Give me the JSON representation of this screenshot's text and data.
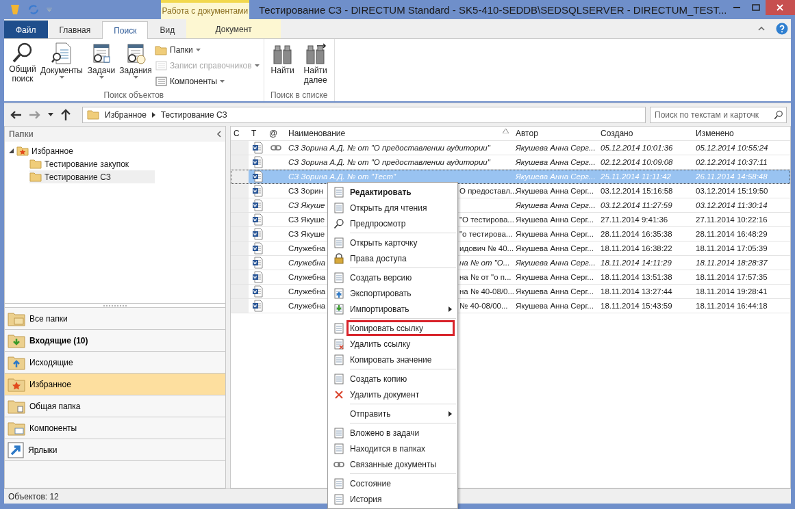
{
  "window": {
    "title": "Тестирование СЗ - DIRECTUM Standard - SK5-410-SEDDB\\SEDSQLSERVER - DIRECTUM_TEST..."
  },
  "context_tab_group": "Работа с документами",
  "ribbon_tabs": [
    {
      "label": "Файл",
      "kind": "file",
      "selected": false
    },
    {
      "label": "Главная",
      "kind": "plain",
      "selected": false
    },
    {
      "label": "Поиск",
      "kind": "plain",
      "selected": true
    },
    {
      "label": "Вид",
      "kind": "plain",
      "selected": false
    },
    {
      "label": "Документ",
      "kind": "context",
      "selected": false
    }
  ],
  "ribbon_groups": [
    {
      "label": "Поиск объектов",
      "buttons": [
        {
          "kind": "large",
          "label": "Общий поиск",
          "dropdown": false,
          "disabled": false
        },
        {
          "kind": "large",
          "label": "Документы",
          "dropdown": true,
          "disabled": false
        },
        {
          "kind": "large",
          "label": "Задачи",
          "dropdown": true,
          "disabled": false
        },
        {
          "kind": "large",
          "label": "Задания",
          "dropdown": true,
          "disabled": false
        },
        {
          "kind": "small",
          "label": "Папки",
          "dropdown": true,
          "disabled": false
        },
        {
          "kind": "small",
          "label": "Записи справочников",
          "dropdown": true,
          "disabled": true
        },
        {
          "kind": "small",
          "label": "Компоненты",
          "dropdown": true,
          "disabled": false
        }
      ]
    },
    {
      "label": "Поиск в списке",
      "buttons": [
        {
          "kind": "large",
          "label": "Найти",
          "dropdown": false,
          "disabled": false
        },
        {
          "kind": "large",
          "label": "Найти далее",
          "dropdown": false,
          "disabled": false
        }
      ]
    }
  ],
  "address_bar": {
    "path": [
      "Избранное",
      "Тестирование СЗ"
    ]
  },
  "search": {
    "placeholder": "Поиск по текстам и карточк"
  },
  "folders_panel": {
    "title": "Папки",
    "tree": [
      {
        "label": "Избранное",
        "expanded": true,
        "selected": false,
        "children": [
          {
            "label": "Тестирование закупок",
            "selected": false
          },
          {
            "label": "Тестирование СЗ",
            "selected": true
          }
        ]
      }
    ]
  },
  "nav_buttons": [
    {
      "label": "Все папки",
      "bold": false,
      "selected": false
    },
    {
      "label": "Входящие (10)",
      "bold": true,
      "selected": false
    },
    {
      "label": "Исходящие",
      "bold": false,
      "selected": false
    },
    {
      "label": "Избранное",
      "bold": false,
      "selected": true
    },
    {
      "label": "Общая папка",
      "bold": false,
      "selected": false
    },
    {
      "label": "Компоненты",
      "bold": false,
      "selected": false
    },
    {
      "label": "Ярлыки",
      "bold": false,
      "selected": false
    }
  ],
  "table": {
    "columns": [
      "С",
      "Т",
      "@",
      "Наименование",
      "Автор",
      "Создано",
      "Изменено"
    ],
    "rows": [
      {
        "name": "СЗ Зорина А.Д. № от \"О предоставлении аудитории\"",
        "name_tail": "",
        "author": "Якушева Анна Серг...",
        "created": "05.12.2014 10:01:36",
        "modified": "05.12.2014 10:55:24",
        "unread": true,
        "linked": true,
        "selected": false
      },
      {
        "name": "СЗ Зорина А.Д. № от \"О предоставлении аудитории\"",
        "name_tail": "",
        "author": "Якушева Анна Серг...",
        "created": "02.12.2014 10:09:08",
        "modified": "02.12.2014 10:37:11",
        "unread": true,
        "linked": false,
        "selected": false
      },
      {
        "name": "СЗ Зорина А.Д. № от \"Тест\"",
        "name_tail": "",
        "author": "Якушева Анна Серг...",
        "created": "25.11.2014 11:11:42",
        "modified": "26.11.2014 14:58:48",
        "unread": true,
        "linked": false,
        "selected": true
      },
      {
        "name": "СЗ Зорин",
        "name_tail": "О предоставл...",
        "author": "Якушева Анна Серг...",
        "created": "03.12.2014 15:16:58",
        "modified": "03.12.2014 15:19:50",
        "unread": false,
        "linked": false,
        "selected": false
      },
      {
        "name": "СЗ Якуше",
        "name_tail": "",
        "author": "Якушева Анна Серг...",
        "created": "03.12.2014 11:27:59",
        "modified": "03.12.2014 11:30:14",
        "unread": true,
        "linked": false,
        "selected": false
      },
      {
        "name": "СЗ Якуше",
        "name_tail": "\"О тестирова...",
        "author": "Якушева Анна Серг...",
        "created": "27.11.2014 9:41:36",
        "modified": "27.11.2014 10:22:16",
        "unread": false,
        "linked": false,
        "selected": false
      },
      {
        "name": "СЗ Якуше",
        "name_tail": "\"о тестирова...",
        "author": "Якушева Анна Серг...",
        "created": "28.11.2014 16:35:38",
        "modified": "28.11.2014 16:48:29",
        "unread": false,
        "linked": false,
        "selected": false
      },
      {
        "name": "Служебна",
        "name_tail": "идович № 40...",
        "author": "Якушева Анна Серг...",
        "created": "18.11.2014 16:38:22",
        "modified": "18.11.2014 17:05:39",
        "unread": false,
        "linked": false,
        "selected": false
      },
      {
        "name": "Служебна",
        "name_tail": "на № от \"О...",
        "author": "Якушева Анна Серг...",
        "created": "18.11.2014 14:11:29",
        "modified": "18.11.2014 18:28:37",
        "unread": true,
        "linked": false,
        "selected": false
      },
      {
        "name": "Служебна",
        "name_tail": "на № от \"о п...",
        "author": "Якушева Анна Серг...",
        "created": "18.11.2014 13:51:38",
        "modified": "18.11.2014 17:57:35",
        "unread": false,
        "linked": false,
        "selected": false
      },
      {
        "name": "Служебна",
        "name_tail": "на № 40-08/0...",
        "author": "Якушева Анна Серг...",
        "created": "18.11.2014 13:27:44",
        "modified": "18.11.2014 19:28:41",
        "unread": false,
        "linked": false,
        "selected": false
      },
      {
        "name": "Служебна",
        "name_tail": "№ 40-08/00...",
        "author": "Якушева Анна Серг...",
        "created": "18.11.2014 15:43:59",
        "modified": "18.11.2014 16:44:18",
        "unread": false,
        "linked": false,
        "selected": false
      }
    ]
  },
  "context_menu": {
    "groups": [
      [
        {
          "label": "Редактировать",
          "default": true,
          "submenu": false,
          "highlighted": false
        },
        {
          "label": "Открыть для чтения",
          "default": false,
          "submenu": false,
          "highlighted": false
        },
        {
          "label": "Предпросмотр",
          "default": false,
          "submenu": false,
          "highlighted": false
        }
      ],
      [
        {
          "label": "Открыть карточку",
          "default": false,
          "submenu": false,
          "highlighted": false
        },
        {
          "label": "Права доступа",
          "default": false,
          "submenu": false,
          "highlighted": false
        }
      ],
      [
        {
          "label": "Создать версию",
          "default": false,
          "submenu": false,
          "highlighted": false
        },
        {
          "label": "Экспортировать",
          "default": false,
          "submenu": false,
          "highlighted": false
        },
        {
          "label": "Импортировать",
          "default": false,
          "submenu": true,
          "highlighted": false
        }
      ],
      [
        {
          "label": "Копировать ссылку",
          "default": false,
          "submenu": false,
          "highlighted": true
        },
        {
          "label": "Удалить ссылку",
          "default": false,
          "submenu": false,
          "highlighted": false
        },
        {
          "label": "Копировать значение",
          "default": false,
          "submenu": false,
          "highlighted": false
        }
      ],
      [
        {
          "label": "Создать копию",
          "default": false,
          "submenu": false,
          "highlighted": false
        },
        {
          "label": "Удалить документ",
          "default": false,
          "submenu": false,
          "highlighted": false
        }
      ],
      [
        {
          "label": "Отправить",
          "default": false,
          "submenu": true,
          "highlighted": false
        }
      ],
      [
        {
          "label": "Вложено в задачи",
          "default": false,
          "submenu": false,
          "highlighted": false
        },
        {
          "label": "Находится в папках",
          "default": false,
          "submenu": false,
          "highlighted": false
        },
        {
          "label": "Связанные документы",
          "default": false,
          "submenu": false,
          "highlighted": false
        }
      ],
      [
        {
          "label": "Состояние",
          "default": false,
          "submenu": false,
          "highlighted": false
        },
        {
          "label": "История",
          "default": false,
          "submenu": false,
          "highlighted": false
        }
      ]
    ]
  },
  "status_bar": {
    "text": "Объектов: 12"
  }
}
